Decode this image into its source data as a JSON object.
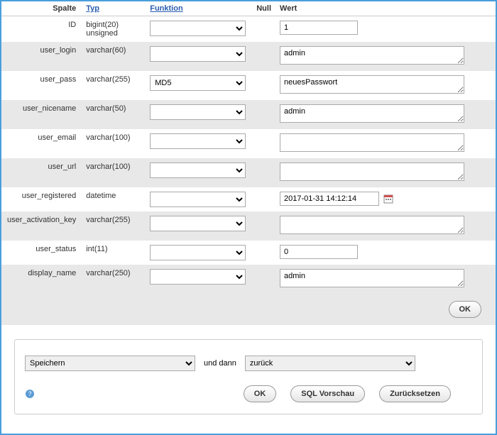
{
  "headers": {
    "spalte": "Spalte",
    "typ": "Typ",
    "funktion": "Funktion",
    "null": "Null",
    "wert": "Wert"
  },
  "rows": [
    {
      "col": "ID",
      "typ": "bigint(20) unsigned",
      "func": "",
      "val": "1",
      "kind": "short"
    },
    {
      "col": "user_login",
      "typ": "varchar(60)",
      "func": "",
      "val": "admin",
      "kind": "ta"
    },
    {
      "col": "user_pass",
      "typ": "varchar(255)",
      "func": "MD5",
      "val": "neuesPasswort",
      "kind": "ta",
      "mono": true
    },
    {
      "col": "user_nicename",
      "typ": "varchar(50)",
      "func": "",
      "val": "admin",
      "kind": "ta"
    },
    {
      "col": "user_email",
      "typ": "varchar(100)",
      "func": "",
      "val": "",
      "kind": "ta"
    },
    {
      "col": "user_url",
      "typ": "varchar(100)",
      "func": "",
      "val": "",
      "kind": "ta"
    },
    {
      "col": "user_registered",
      "typ": "datetime",
      "func": "",
      "val": "2017-01-31 14:12:14",
      "kind": "date"
    },
    {
      "col": "user_activation_key",
      "typ": "varchar(255)",
      "func": "",
      "val": "",
      "kind": "ta"
    },
    {
      "col": "user_status",
      "typ": "int(11)",
      "func": "",
      "val": "0",
      "kind": "short"
    },
    {
      "col": "display_name",
      "typ": "varchar(250)",
      "func": "",
      "val": "admin",
      "kind": "ta"
    }
  ],
  "ok_button": "OK",
  "bottom": {
    "save_label": "Speichern",
    "und_dann": "und dann",
    "back_label": "zurück",
    "ok": "OK",
    "sql_preview": "SQL Vorschau",
    "reset": "Zurücksetzen"
  }
}
